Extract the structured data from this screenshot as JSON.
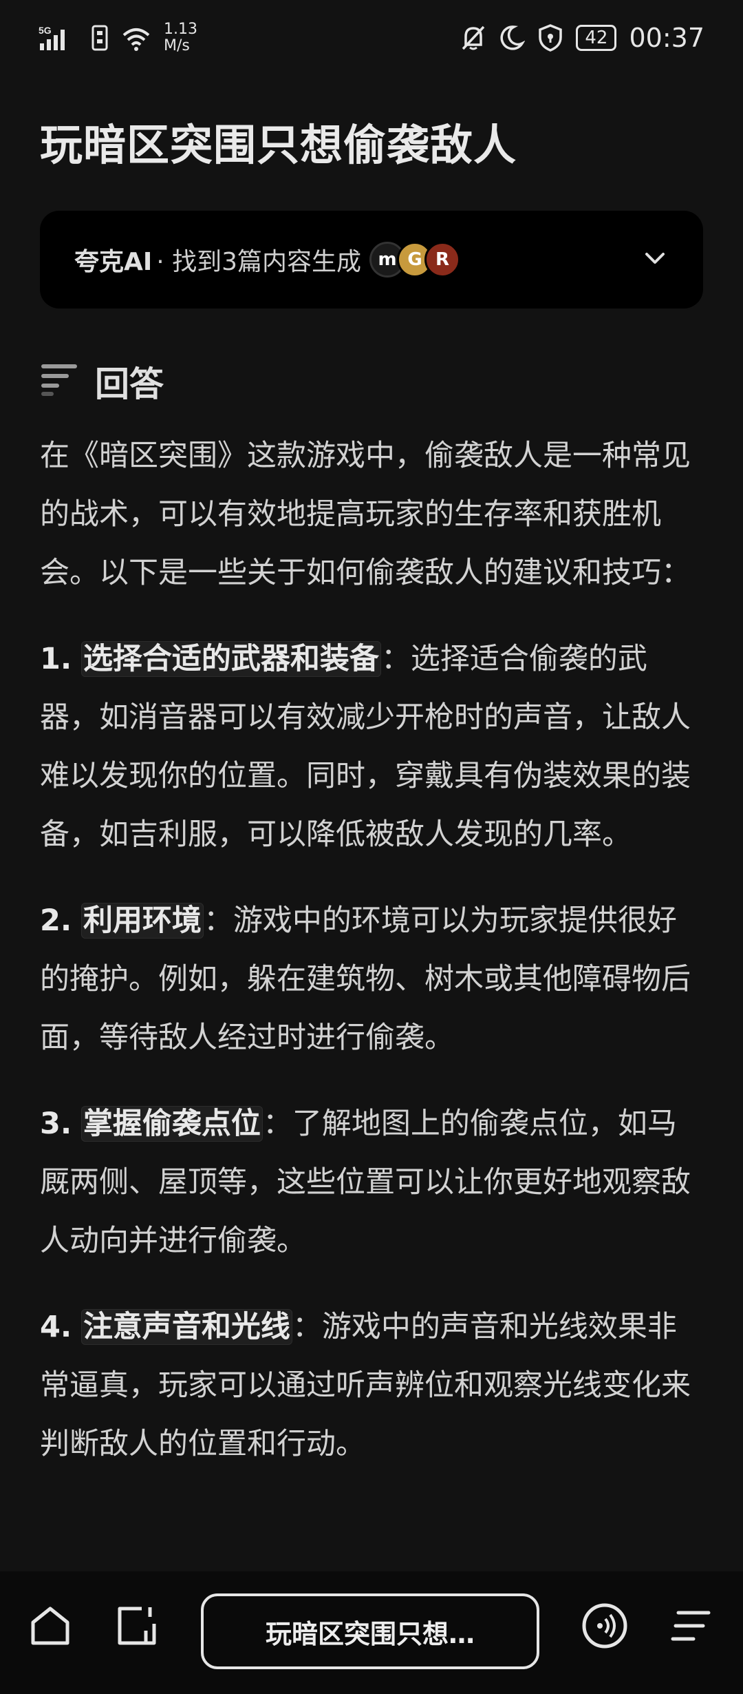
{
  "status_bar": {
    "network": "5G",
    "speed_value": "1.13",
    "speed_unit": "M/s",
    "battery": "42",
    "time": "00:37"
  },
  "page": {
    "title": "玩暗区突围只想偷袭敌人"
  },
  "source": {
    "brand": "夸克AI",
    "desc": " · 找到3篇内容生成",
    "avatars": [
      {
        "letter": "m",
        "color": "#1a1a1a"
      },
      {
        "letter": "G",
        "color": "#c79a3d"
      },
      {
        "letter": "R",
        "color": "#8a2a1a"
      }
    ]
  },
  "answer": {
    "heading": "回答",
    "intro": "在《暗区突围》这款游戏中，偷袭敌人是一种常见的战术，可以有效地提高玩家的生存率和获胜机会。以下是一些关于如何偷袭敌人的建议和技巧：",
    "items": [
      {
        "num": "1.",
        "title": "选择合适的武器和装备",
        "text": "：选择适合偷袭的武器，如消音器可以有效减少开枪时的声音，让敌人难以发现你的位置。同时，穿戴具有伪装效果的装备，如吉利服，可以降低被敌人发现的几率。"
      },
      {
        "num": "2.",
        "title": "利用环境",
        "text": "：游戏中的环境可以为玩家提供很好的掩护。例如，躲在建筑物、树木或其他障碍物后面，等待敌人经过时进行偷袭。"
      },
      {
        "num": "3.",
        "title": "掌握偷袭点位",
        "text": "：了解地图上的偷袭点位，如马厩两侧、屋顶等，这些位置可以让你更好地观察敌人动向并进行偷袭。"
      },
      {
        "num": "4.",
        "title": "注意声音和光线",
        "text": "：游戏中的声音和光线效果非常逼真，玩家可以通过听声辨位和观察光线变化来判断敌人的位置和行动。"
      }
    ]
  },
  "bottom_bar": {
    "pill_label": "玩暗区突围只想…"
  }
}
